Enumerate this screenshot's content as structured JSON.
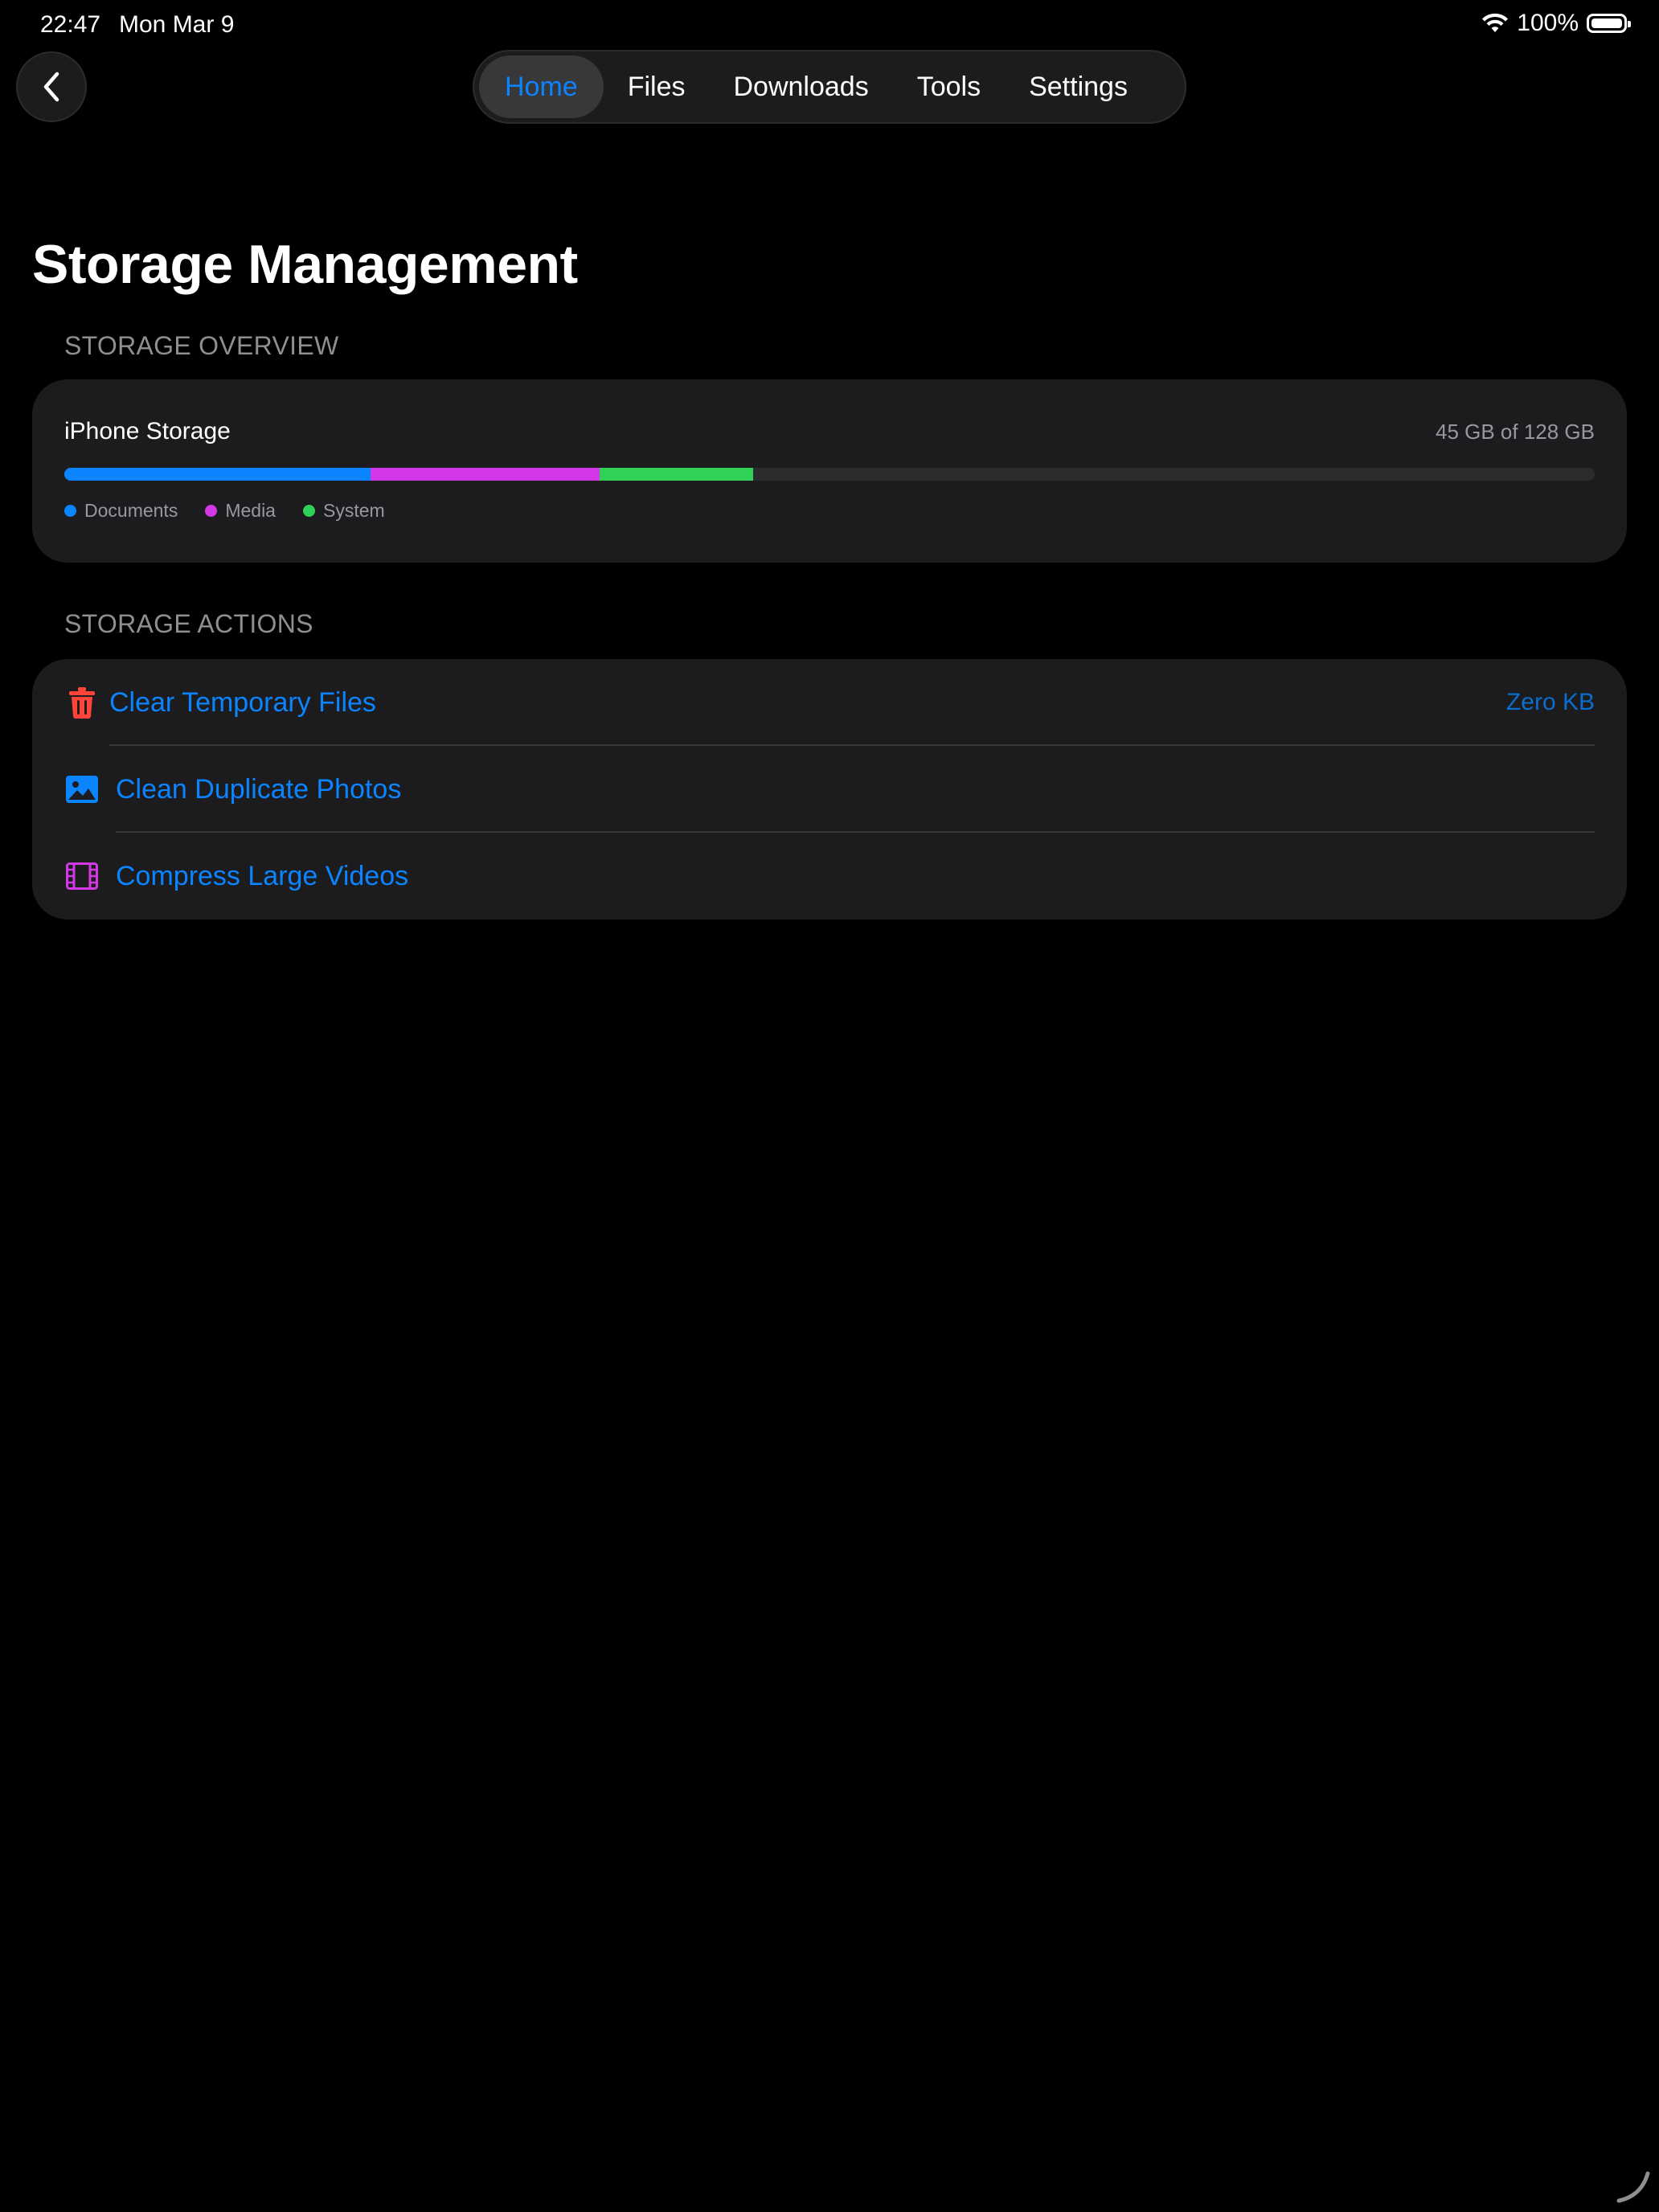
{
  "status_bar": {
    "time": "22:47",
    "date": "Mon Mar 9",
    "battery_percent": "100%"
  },
  "nav": {
    "tabs": [
      {
        "label": "Home",
        "active": true
      },
      {
        "label": "Files",
        "active": false
      },
      {
        "label": "Downloads",
        "active": false
      },
      {
        "label": "Tools",
        "active": false
      },
      {
        "label": "Settings",
        "active": false
      }
    ]
  },
  "page": {
    "title": "Storage Management"
  },
  "overview": {
    "header": "STORAGE OVERVIEW",
    "device_label": "iPhone Storage",
    "usage_text": "45 GB of 128 GB",
    "segments": [
      {
        "name": "Documents",
        "color": "#0a84ff",
        "fraction": 0.2
      },
      {
        "name": "Media",
        "color": "#d238e5",
        "fraction": 0.15
      },
      {
        "name": "System",
        "color": "#30d158",
        "fraction": 0.1
      }
    ],
    "track_color": "#2c2c2e"
  },
  "actions": {
    "header": "STORAGE ACTIONS",
    "items": [
      {
        "label": "Clear Temporary Files",
        "value": "Zero KB",
        "icon": "trash-icon",
        "icon_color": "#ff453a"
      },
      {
        "label": "Clean Duplicate Photos",
        "value": "",
        "icon": "photo-icon",
        "icon_color": "#0a84ff"
      },
      {
        "label": "Compress Large Videos",
        "value": "",
        "icon": "film-icon",
        "icon_color": "#d238e5"
      }
    ]
  },
  "colors": {
    "accent": "#0a84ff",
    "background": "#000000",
    "card": "#1c1c1e",
    "secondary_text": "#8e8e93"
  }
}
